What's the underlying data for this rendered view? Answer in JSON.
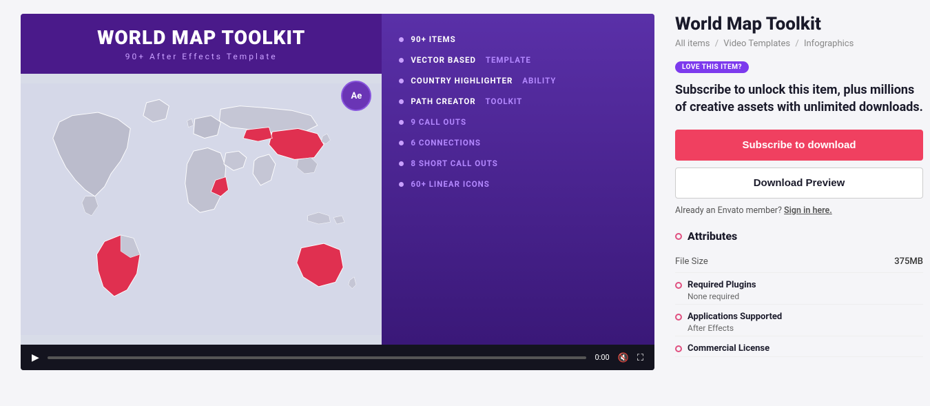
{
  "product": {
    "title": "World Map Toolkit",
    "breadcrumb": {
      "items": [
        "All items",
        "Video Templates",
        "Infographics"
      ],
      "separators": [
        "/",
        "/"
      ]
    },
    "love_badge": "LOVE THIS ITEM?",
    "subscribe_text": "Subscribe to unlock this item, plus millions of creative assets with unlimited downloads.",
    "btn_subscribe": "Subscribe to download",
    "btn_download_preview": "Download Preview",
    "member_text": "Already an Envato member? Sign in here.",
    "attributes_title": "Attributes",
    "attributes": [
      {
        "label": "File Size",
        "value": "375MB"
      }
    ],
    "attribute_sections": [
      {
        "title": "Required Plugins",
        "value": "None required"
      },
      {
        "title": "Applications Supported",
        "value": "After Effects"
      },
      {
        "title": "Commercial License",
        "value": ""
      }
    ]
  },
  "video": {
    "title": "WORLD MAP TOOLKIT",
    "subtitle": "90+ After Effects Template",
    "ae_badge": "Ae",
    "features": [
      {
        "text": "90+ ITEMS",
        "style": "white"
      },
      {
        "text1": "VECTOR BASED ",
        "text1_style": "white",
        "text2": "TEMPLATE",
        "text2_style": "purple"
      },
      {
        "text1": "COUNTRY HIGHLIGHTER ",
        "text1_style": "white",
        "text2": "ABILITY",
        "text2_style": "purple"
      },
      {
        "text1": "PATH CREATOR ",
        "text1_style": "white",
        "text2": "TOOLKIT",
        "text2_style": "purple"
      },
      {
        "text": "9 CALL OUTS",
        "style": "purple"
      },
      {
        "text": "6 CONNECTIONS",
        "style": "purple"
      },
      {
        "text": "8 SHORT CALL OUTS",
        "style": "purple"
      },
      {
        "text": "60+ LINEAR ICONS",
        "style": "purple"
      }
    ],
    "controls": {
      "time": "0:00"
    }
  },
  "icons": {
    "play": "▶",
    "volume_mute": "🔇",
    "fullscreen": "⛶",
    "breadcrumb_sep": "/"
  }
}
